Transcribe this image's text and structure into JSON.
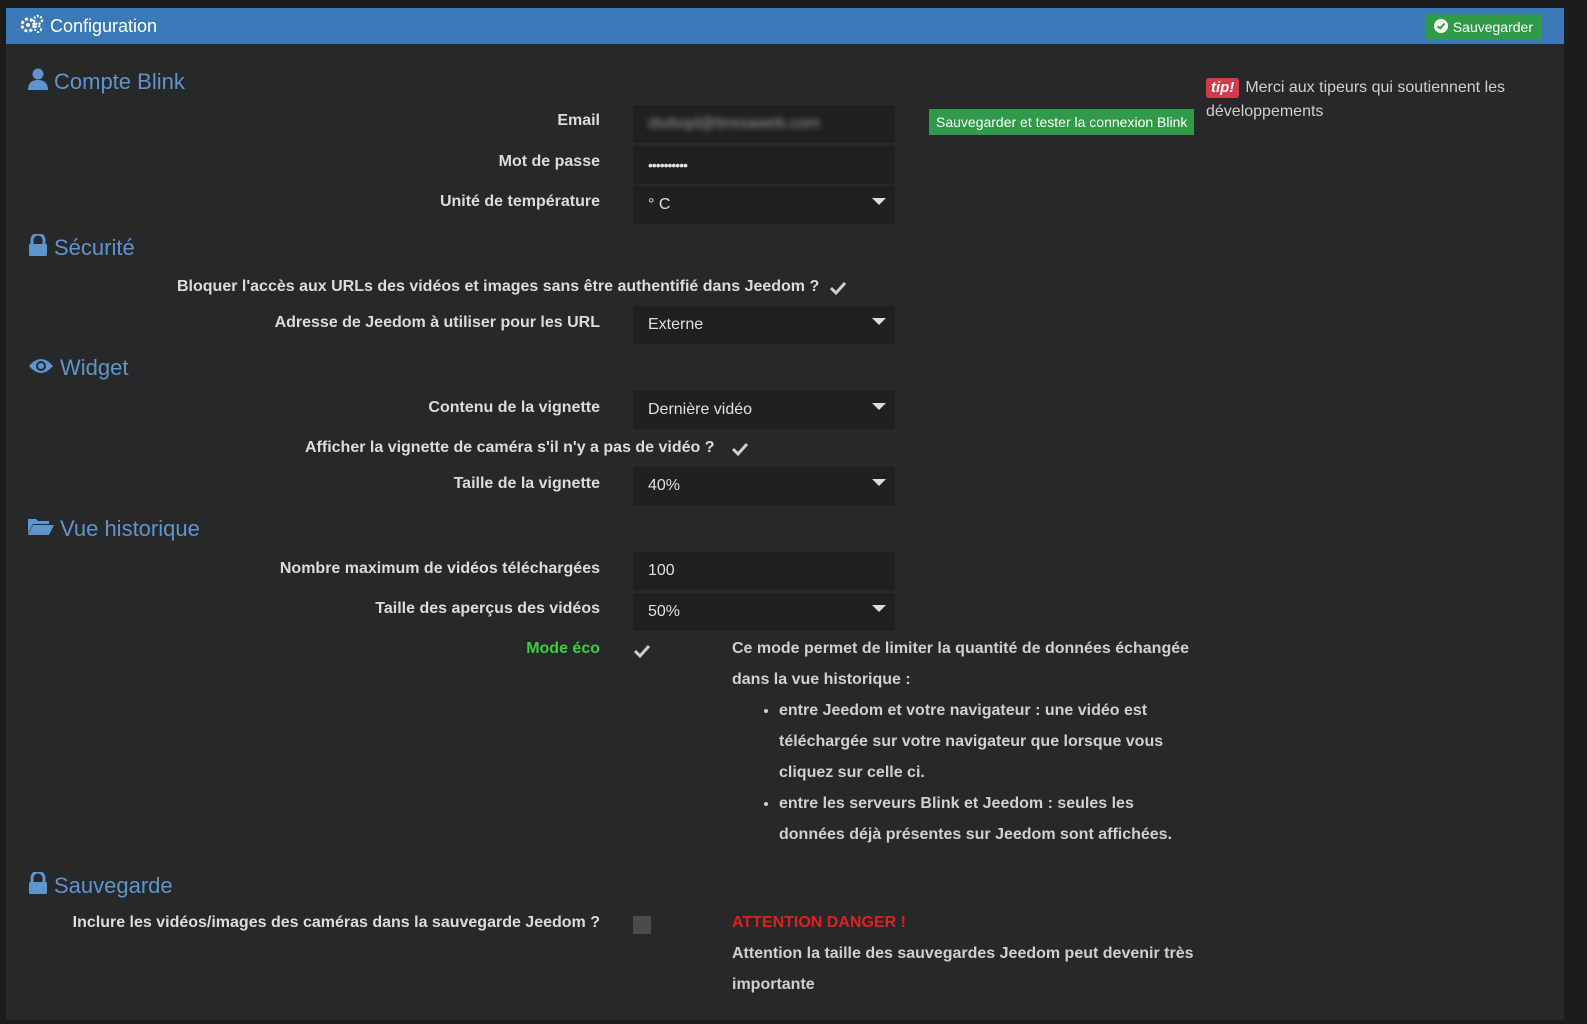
{
  "header": {
    "title": "Configuration",
    "save_label": "Sauvegarder"
  },
  "account": {
    "section_title": "Compte Blink",
    "email_label": "Email",
    "email_value": "dsdsqd@bresaweb.com",
    "password_label": "Mot de passe",
    "password_value": "••••••••••",
    "temperature_label": "Unité de température",
    "temperature_value": "° C",
    "test_button": "Sauvegarder et tester la connexion Blink"
  },
  "tip": {
    "badge": "tip!",
    "text": "Merci aux tipeurs qui soutiennent les développements"
  },
  "security": {
    "section_title": "Sécurité",
    "block_label": "Bloquer l'accès aux URLs des vidéos et images sans être authentifié dans Jeedom ?",
    "url_label": "Adresse de Jeedom à utiliser pour les URL",
    "url_value": "Externe"
  },
  "widget": {
    "section_title": "Widget",
    "content_label": "Contenu de la vignette",
    "content_value": "Dernière vidéo",
    "show_thumb_label": "Afficher la vignette de caméra s'il n'y a pas de vidéo ?",
    "size_label": "Taille de la vignette",
    "size_value": "40%"
  },
  "history": {
    "section_title": "Vue historique",
    "max_label": "Nombre maximum de vidéos téléchargées",
    "max_value": "100",
    "preview_label": "Taille des aperçus des vidéos",
    "preview_value": "50%",
    "eco_label": "Mode éco",
    "eco_help_intro": "Ce mode permet de limiter la quantité de données échangée dans la vue historique :",
    "eco_help_items": [
      "entre Jeedom et votre navigateur : une vidéo est téléchargée sur votre navigateur que lorsque vous cliquez sur celle ci.",
      "entre les serveurs Blink et Jeedom : seules les données déjà présentes sur Jeedom sont affichées."
    ]
  },
  "backup": {
    "section_title": "Sauvegarde",
    "include_label": "Inclure les vidéos/images des caméras dans la sauvegarde Jeedom ?",
    "danger_title": "ATTENTION DANGER !",
    "danger_text": "Attention la taille des sauvegardes Jeedom peut devenir très importante"
  },
  "colors": {
    "header": "#3a78b8",
    "section": "#5f95cc",
    "success": "#2f9a47",
    "danger": "#e02020",
    "eco": "#3ccf3c"
  }
}
